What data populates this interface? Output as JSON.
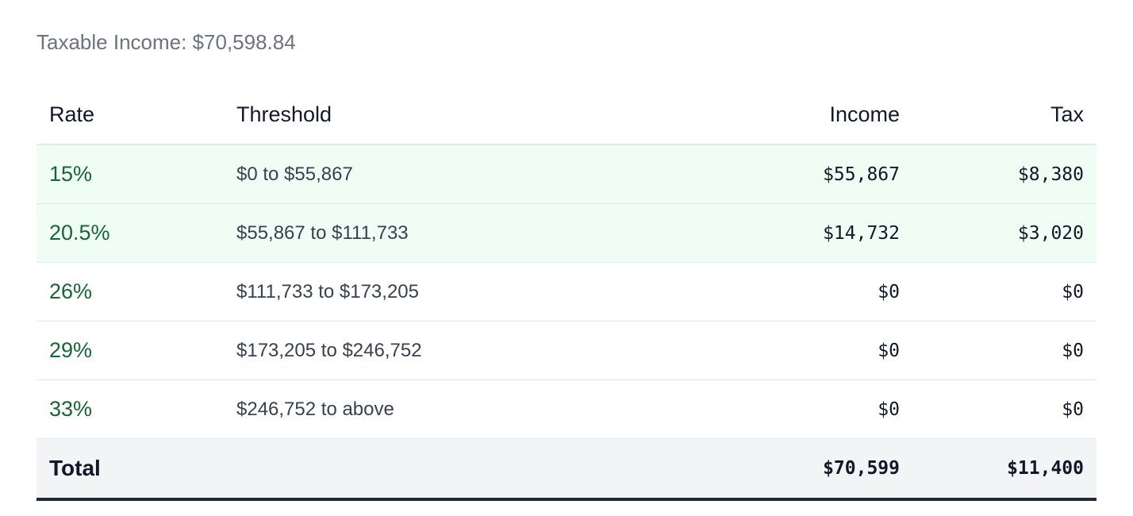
{
  "summary": {
    "label": "Taxable Income: $70,598.84"
  },
  "table": {
    "headers": {
      "rate": "Rate",
      "threshold": "Threshold",
      "income": "Income",
      "tax": "Tax"
    },
    "rows": [
      {
        "rate": "15%",
        "threshold": "$0 to $55,867",
        "income": "$55,867",
        "tax": "$8,380",
        "active": true
      },
      {
        "rate": "20.5%",
        "threshold": "$55,867 to $111,733",
        "income": "$14,732",
        "tax": "$3,020",
        "active": true
      },
      {
        "rate": "26%",
        "threshold": "$111,733 to $173,205",
        "income": "$0",
        "tax": "$0",
        "active": false
      },
      {
        "rate": "29%",
        "threshold": "$173,205 to $246,752",
        "income": "$0",
        "tax": "$0",
        "active": false
      },
      {
        "rate": "33%",
        "threshold": "$246,752 to above",
        "income": "$0",
        "tax": "$0",
        "active": false
      }
    ],
    "total": {
      "label": "Total",
      "income": "$70,599",
      "tax": "$11,400"
    }
  },
  "colors": {
    "active_row_bg": "#f0fdf4",
    "rate_text": "#166534",
    "total_bg": "#f3f4f6",
    "total_border": "#1f2937"
  }
}
